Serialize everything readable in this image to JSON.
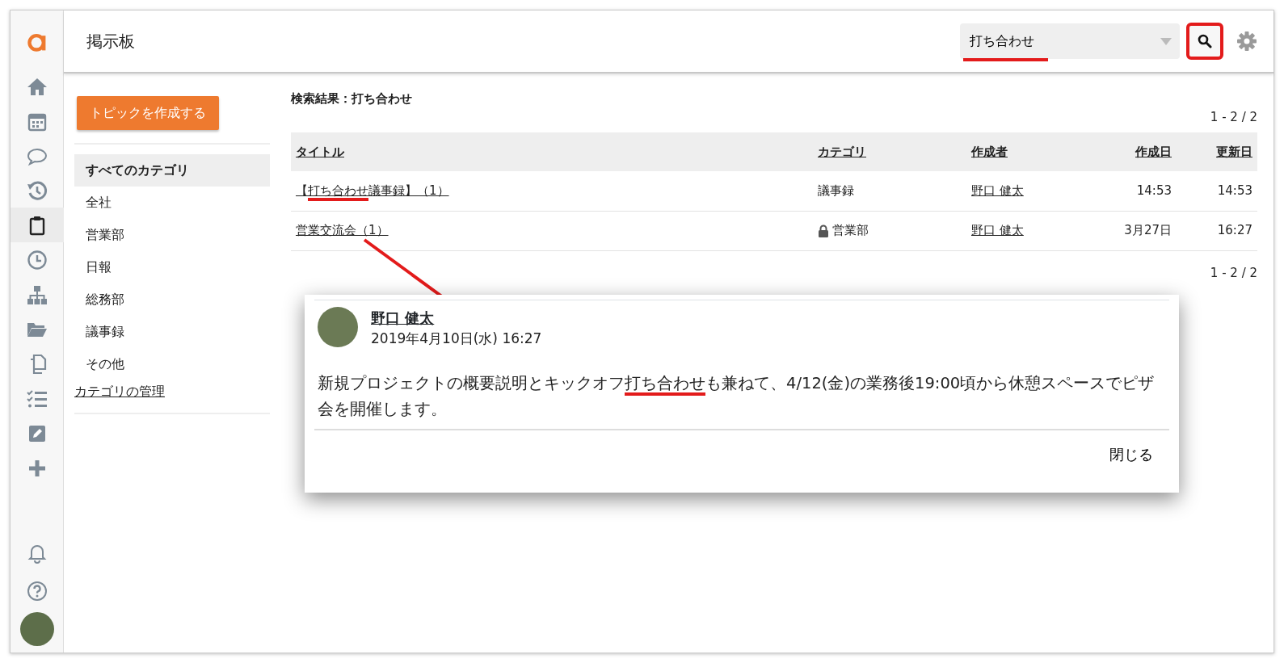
{
  "app_nav": [
    {
      "kind": "logo"
    },
    {
      "kind": "home",
      "selected": false
    },
    {
      "kind": "calendar",
      "selected": false
    },
    {
      "kind": "chat",
      "selected": false
    },
    {
      "kind": "history",
      "selected": false
    },
    {
      "kind": "clipboard",
      "selected": true
    },
    {
      "kind": "clock",
      "selected": false
    },
    {
      "kind": "org",
      "selected": false
    },
    {
      "kind": "folder",
      "selected": false
    },
    {
      "kind": "copy",
      "selected": false
    },
    {
      "kind": "checklist",
      "selected": false
    },
    {
      "kind": "edit",
      "selected": false
    },
    {
      "kind": "plus",
      "selected": false
    }
  ],
  "app_nav_bottom": [
    {
      "kind": "bell"
    },
    {
      "kind": "help"
    },
    {
      "kind": "avatar"
    }
  ],
  "header": {
    "title": "掲示板",
    "search": {
      "value": "打ち合わせ",
      "highlighted": true
    },
    "search_button": {
      "highlighted": true
    }
  },
  "sidebar": {
    "create_button": "トピックを作成する",
    "categories": [
      {
        "label": "すべてのカテゴリ",
        "selected": true
      },
      {
        "label": "全社",
        "selected": false
      },
      {
        "label": "営業部",
        "selected": false
      },
      {
        "label": "日報",
        "selected": false
      },
      {
        "label": "総務部",
        "selected": false
      },
      {
        "label": "議事録",
        "selected": false
      },
      {
        "label": "その他",
        "selected": false
      }
    ],
    "manage_link": "カテゴリの管理"
  },
  "results": {
    "heading": "検索結果：打ち合わせ",
    "pagination_top": "1 - 2 / 2",
    "pagination_bottom": "1 - 2 / 2",
    "columns": [
      "タイトル",
      "カテゴリ",
      "作成者",
      "作成日",
      "更新日"
    ],
    "rows": [
      {
        "title": [
          {
            "text": "【",
            "highlighted": false
          },
          {
            "text": "打ち合わせ",
            "highlighted": true
          },
          {
            "text": "議事録】（1）",
            "highlighted": false
          }
        ],
        "category": "議事録",
        "locked": false,
        "author": "野口 健太",
        "created": "14:53",
        "updated": "14:53"
      },
      {
        "title": [
          {
            "text": "営業交流会（1）",
            "highlighted": false
          }
        ],
        "category": "営業部",
        "locked": true,
        "author": "野口 健太",
        "created": "3月27日",
        "updated": "16:27"
      }
    ]
  },
  "popup": {
    "author": "野口 健太",
    "date": "2019年4月10日(水) 16:27",
    "body": [
      {
        "text": "新規プロジェクトの概要説明とキックオフ",
        "highlighted": false
      },
      {
        "text": "打ち合わせ",
        "highlighted": true
      },
      {
        "text": "も兼ねて、4/12(金)の業務後19:00頃から休憩スペースでピザ会を開催します。",
        "highlighted": false
      }
    ],
    "close_button": "閉じる"
  }
}
